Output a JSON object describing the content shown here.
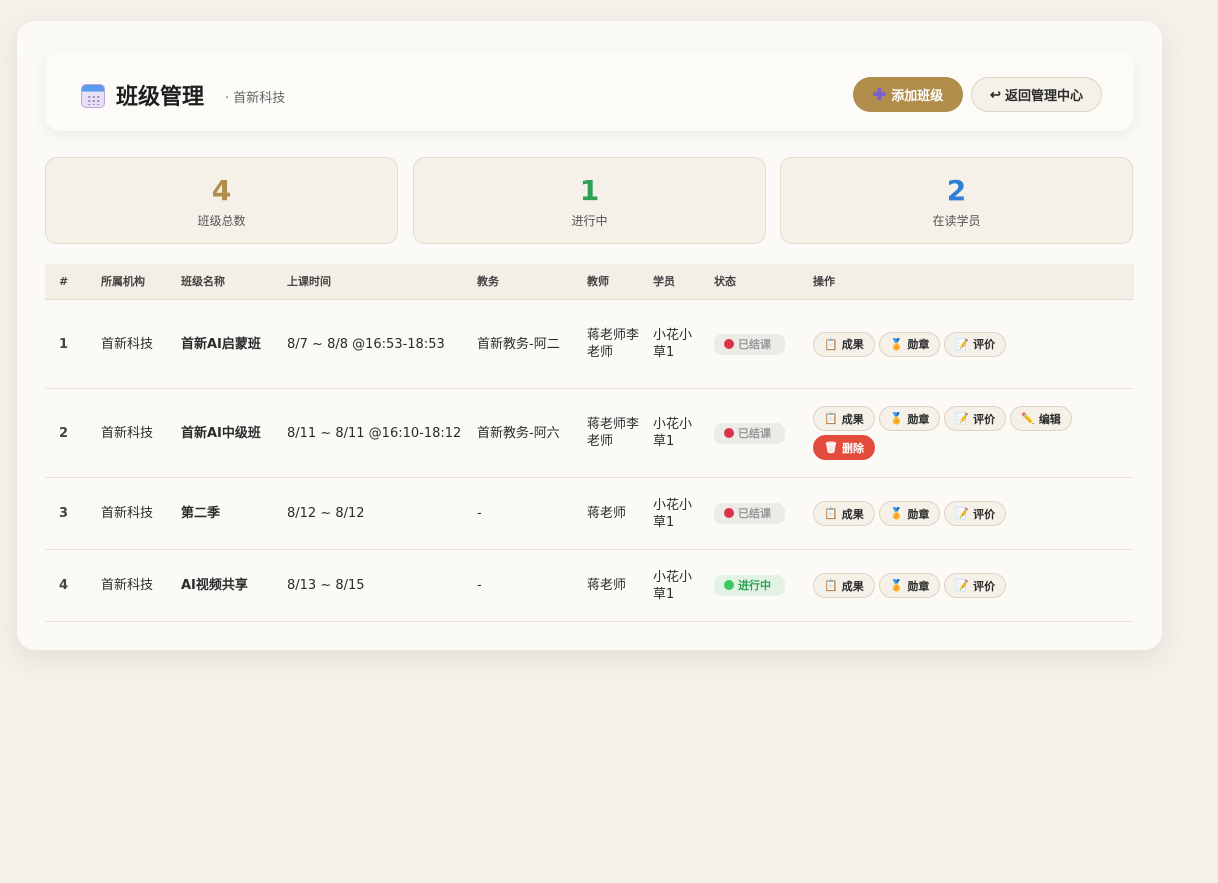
{
  "header": {
    "title": "班级管理",
    "subtitle": "· 首新科技",
    "add_label": "添加班级",
    "back_label": "返回管理中心"
  },
  "stats": [
    {
      "value": "4",
      "label": "班级总数",
      "color": "#b08d4a"
    },
    {
      "value": "1",
      "label": "进行中",
      "color": "#2ea055"
    },
    {
      "value": "2",
      "label": "在读学员",
      "color": "#2f7fd6"
    }
  ],
  "table": {
    "columns": [
      "#",
      "所属机构",
      "班级名称",
      "上课时间",
      "教务",
      "教师",
      "学员",
      "状态",
      "操作"
    ],
    "rows": [
      {
        "no": "1",
        "org": "首新科技",
        "name": "首新AI启蒙班",
        "time": "8/7 ~ 8/8 @16:53-18:53",
        "admin": "首新教务-阿二",
        "teacher": "蒋老师李老师",
        "students": "小花小草1",
        "status": "已结课",
        "status_kind": "done",
        "actions": [
          "成果",
          "勋章",
          "评价"
        ]
      },
      {
        "no": "2",
        "org": "首新科技",
        "name": "首新AI中级班",
        "time": "8/11 ~ 8/11 @16:10-18:12",
        "admin": "首新教务-阿六",
        "teacher": "蒋老师李老师",
        "students": "小花小草1",
        "status": "已结课",
        "status_kind": "done",
        "actions": [
          "成果",
          "勋章",
          "评价",
          "编辑",
          "删除"
        ]
      },
      {
        "no": "3",
        "org": "首新科技",
        "name": "第二季",
        "time": "8/12 ~ 8/12",
        "admin": "-",
        "teacher": "蒋老师",
        "students": "小花小草1",
        "status": "已结课",
        "status_kind": "done",
        "actions": [
          "成果",
          "勋章",
          "评价"
        ]
      },
      {
        "no": "4",
        "org": "首新科技",
        "name": "AI视频共享",
        "time": "8/13 ~ 8/15",
        "admin": "-",
        "teacher": "蒋老师",
        "students": "小花小草1",
        "status": "进行中",
        "status_kind": "running",
        "actions": [
          "成果",
          "勋章",
          "评价"
        ]
      }
    ]
  },
  "icons": {
    "成果": "clipboard-icon",
    "勋章": "medal-icon",
    "评价": "memo-icon",
    "编辑": "pencil-icon",
    "删除": "trash-icon"
  }
}
